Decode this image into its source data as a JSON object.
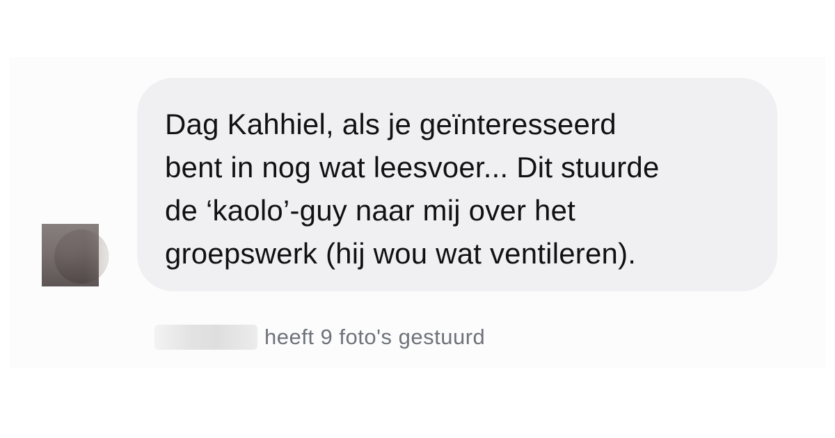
{
  "message": {
    "lines": [
      "Dag Kahhiel, als je geïnteresseerd",
      "bent in nog wat leesvoer... Dit stuurde",
      "de ‘kaolo’-guy naar mij over het",
      "groepswerk (hij wou wat ventileren)."
    ]
  },
  "status": {
    "text": "heeft 9 foto's gestuurd"
  },
  "colors": {
    "bubble": "#f0f0f2",
    "message_text": "#111111",
    "status_text": "#6f727a"
  },
  "icons": {
    "avatar": "avatar-blurred"
  }
}
